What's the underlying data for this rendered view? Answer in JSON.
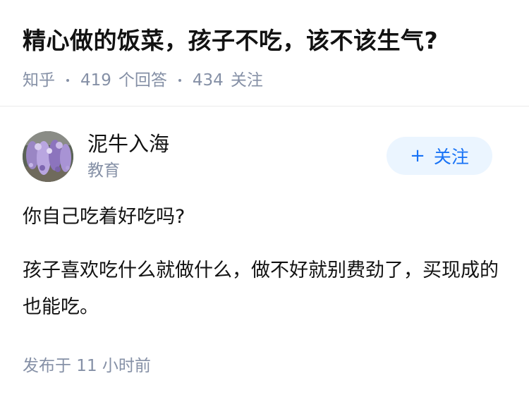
{
  "question": {
    "title": "精心做的饭菜，孩子不吃，该不该生气?",
    "source": "知乎",
    "answer_count": "419",
    "answer_label": "个回答",
    "follow_count": "434",
    "follow_label": "关注"
  },
  "answer": {
    "author": {
      "name": "泥牛入海",
      "tag": "教育",
      "avatar_icon": "wisteria-flowers-avatar"
    },
    "follow_button": {
      "icon": "plus-icon",
      "plus": "+",
      "label": "关注"
    },
    "paragraphs": [
      "你自己吃着好吃吗?",
      "孩子喜欢吃什么就做什么，做不好就别费劲了，买现成的也能吃。"
    ],
    "published": "发布于 11 小时前"
  },
  "colors": {
    "text_primary": "#121212",
    "text_secondary": "#8590a6",
    "follow_button_bg": "#ebf5ff",
    "follow_button_text": "#1772f6",
    "divider": "#ebebeb"
  }
}
